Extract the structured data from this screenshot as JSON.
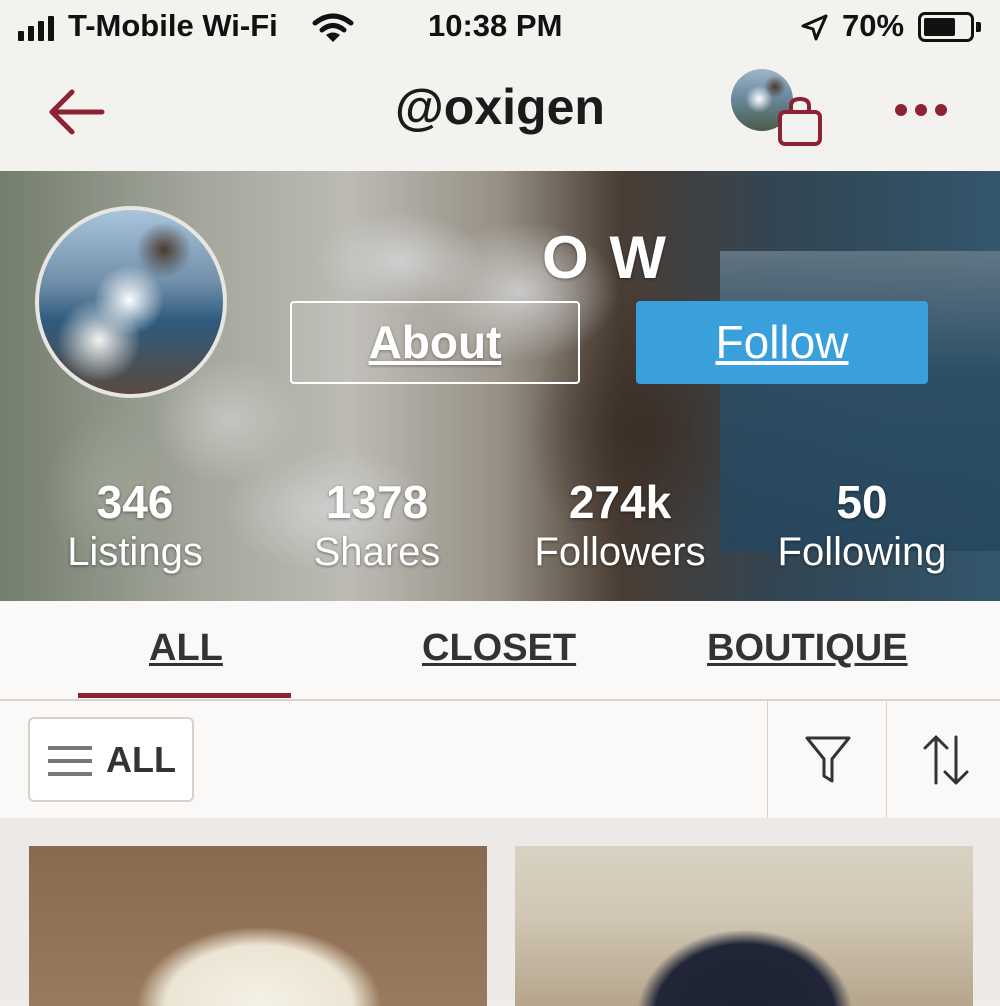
{
  "status_bar": {
    "carrier": "T-Mobile Wi-Fi",
    "time": "10:38 PM",
    "battery_percent": "70%",
    "battery_level": 0.7
  },
  "nav": {
    "title": "@oxigen",
    "back_icon": "back-arrow-icon",
    "bag_icon": "shopping-bag-icon",
    "more_icon": "more-dots-icon"
  },
  "profile": {
    "display_name": "O W",
    "about_label": "About",
    "follow_label": "Follow",
    "stats": [
      {
        "value": "346",
        "label": "Listings"
      },
      {
        "value": "1378",
        "label": "Shares"
      },
      {
        "value": "274k",
        "label": "Followers"
      },
      {
        "value": "50",
        "label": "Following"
      }
    ]
  },
  "tabs": [
    {
      "label": "ALL",
      "active": true
    },
    {
      "label": "CLOSET",
      "active": false
    },
    {
      "label": "BOUTIQUE",
      "active": false
    }
  ],
  "filter": {
    "all_label": "ALL",
    "filter_icon": "filter-funnel-icon",
    "sort_icon": "sort-arrows-icon"
  },
  "colors": {
    "accent": "#8c2333",
    "follow_blue": "#3aa0dc"
  }
}
